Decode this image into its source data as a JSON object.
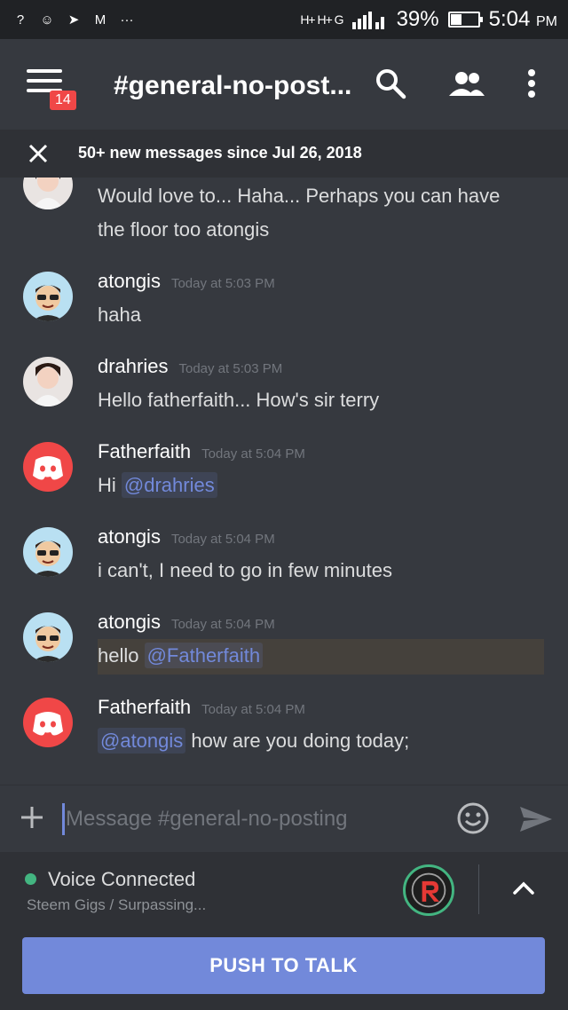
{
  "status_bar": {
    "left_glyphs": [
      "?",
      "☺",
      "➤",
      "M",
      "···"
    ],
    "signal_text": "H+ H+ G",
    "battery": "39%",
    "battery_level": 0.39,
    "time": "5:04",
    "ampm": "PM"
  },
  "toolbar": {
    "menu_badge": "14",
    "channel_title": "#general-no-post...",
    "icons": [
      "menu-icon",
      "search-icon",
      "members-icon",
      "more-vertical-icon"
    ]
  },
  "new_messages_bar": {
    "text": "50+ new messages since Jul 26, 2018"
  },
  "messages": [
    {
      "author": "",
      "timestamp": "",
      "lines": [
        "Would love to... Haha... Perhaps you can have",
        "the floor too atongis"
      ],
      "avatar": "drahries"
    },
    {
      "author": "atongis",
      "timestamp": "Today at 5:03 PM",
      "text": "haha",
      "avatar": "atongis"
    },
    {
      "author": "drahries",
      "timestamp": "Today at 5:03 PM",
      "text": "Hello fatherfaith...  How's sir terry",
      "avatar": "drahries"
    },
    {
      "author": "Fatherfaith",
      "timestamp": "Today at 5:04 PM",
      "prefix": "Hi ",
      "mention": "@drahries",
      "suffix": "",
      "avatar": "discord"
    },
    {
      "author": "atongis",
      "timestamp": "Today at 5:04 PM",
      "text": "i can't, I need to go in few minutes",
      "avatar": "atongis"
    },
    {
      "author": "atongis",
      "timestamp": "Today at 5:04 PM",
      "prefix": "hello ",
      "mention": "@Fatherfaith",
      "suffix": "",
      "avatar": "atongis"
    },
    {
      "author": "Fatherfaith",
      "timestamp": "Today at 5:04 PM",
      "prefix": "",
      "mention": "@atongis",
      "suffix": " how are you doing today;",
      "avatar": "discord"
    }
  ],
  "input": {
    "placeholder": "Message #general-no-posting"
  },
  "voice": {
    "status": "Voice Connected",
    "channel": "Steem Gigs / Surpassing..."
  },
  "push_to_talk_label": "PUSH TO TALK",
  "colors": {
    "accent": "#7289da",
    "online": "#43b581",
    "badge": "#f04747",
    "discord_red": "#f04747"
  }
}
